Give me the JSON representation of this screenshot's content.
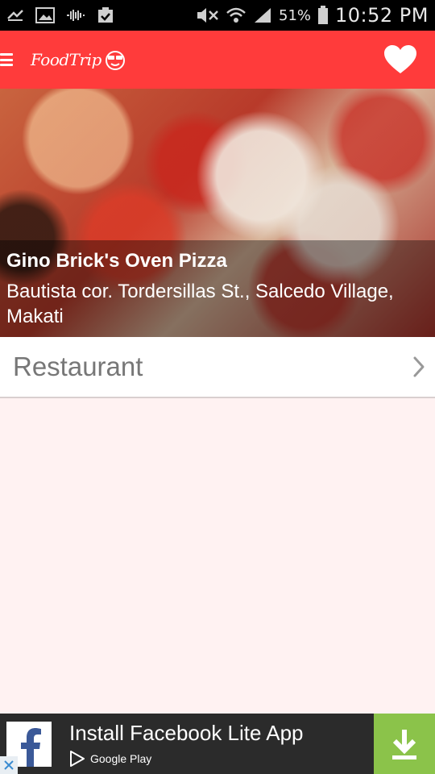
{
  "status_bar": {
    "battery": "51%",
    "time": "10:52 PM",
    "icons": [
      "missed-call-icon",
      "image-icon",
      "voicemail-icon",
      "clipboard-check-icon",
      "mute-icon",
      "wifi-icon",
      "signal-icon",
      "battery-icon"
    ]
  },
  "app_bar": {
    "logo_text": "FoodTrip",
    "menu_icon": "hamburger-icon",
    "favorite_icon": "heart-icon",
    "color": "#ff3b3b"
  },
  "hero": {
    "title": "Gino Brick's Oven Pizza",
    "address": "Bautista cor. Tordersillas St., Salcedo Village, Makati"
  },
  "category_row": {
    "label": "Restaurant",
    "icon": "chevron-right-icon"
  },
  "ad": {
    "title": "Install Facebook Lite App",
    "store": "Google Play",
    "icons": [
      "facebook-icon",
      "google-play-icon",
      "download-icon",
      "close-icon"
    ],
    "accent": "#8bc34a"
  },
  "colors": {
    "background": "#fff2f2",
    "brand_red": "#ff3b3b"
  }
}
